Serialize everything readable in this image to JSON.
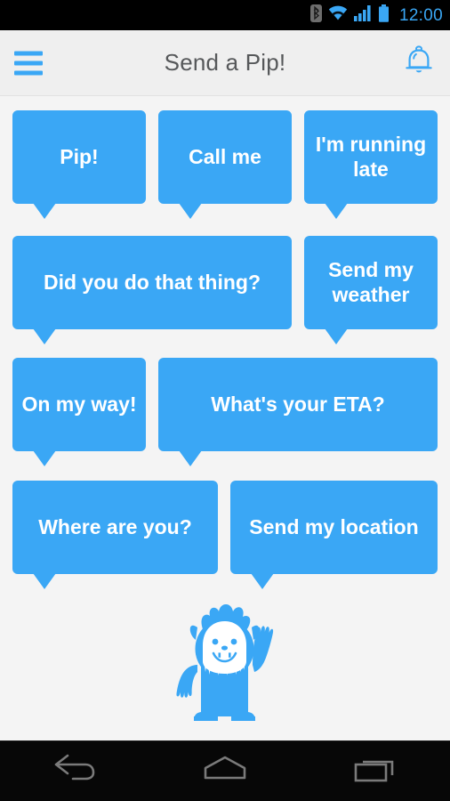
{
  "status_bar": {
    "time": "12:00",
    "time_color": "#3AA7F5",
    "background": "#000000",
    "icons": [
      {
        "name": "bluetooth-icon",
        "color": "#8a8a8a"
      },
      {
        "name": "wifi-icon",
        "color": "#3AA7F5"
      },
      {
        "name": "cellular-signal-icon",
        "color": "#3AA7F5"
      },
      {
        "name": "battery-icon",
        "color": "#3AA7F5"
      }
    ]
  },
  "header": {
    "title": "Send a Pip!",
    "title_color": "#56585a",
    "background": "#efefef",
    "menu_icon": "hamburger-menu-icon",
    "notification_icon": "bell-icon",
    "accent_color": "#3AA7F5"
  },
  "theme": {
    "bubble_blue": "#3AA7F5",
    "page_background": "#f4f4f4",
    "bubble_text": "#ffffff"
  },
  "bubbles": {
    "rows": [
      {
        "items": [
          {
            "id": "pip",
            "label": "Pip!"
          },
          {
            "id": "call-me",
            "label": "Call me"
          },
          {
            "id": "im-running-late",
            "label": "I'm running late"
          }
        ]
      },
      {
        "items": [
          {
            "id": "did-you-do-that-thing",
            "label": "Did you do that thing?"
          },
          {
            "id": "send-my-weather",
            "label": "Send my weather"
          }
        ]
      },
      {
        "items": [
          {
            "id": "on-my-way",
            "label": "On my way!"
          },
          {
            "id": "whats-your-eta",
            "label": "What's your ETA?"
          }
        ]
      },
      {
        "items": [
          {
            "id": "where-are-you",
            "label": "Where are you?"
          },
          {
            "id": "send-my-location",
            "label": "Send my location"
          }
        ]
      }
    ]
  },
  "mascot": {
    "name": "pip-yeti-mascot",
    "body_color": "#3AA7F5",
    "face_color": "#ffffff",
    "description": "Blue yeti character waving one arm"
  },
  "nav_bar": {
    "background": "#070707",
    "icon_color": "#7a7a7a",
    "buttons": [
      {
        "id": "back",
        "icon": "back-arrow-icon"
      },
      {
        "id": "home",
        "icon": "home-icon"
      },
      {
        "id": "recents",
        "icon": "recent-apps-icon"
      }
    ]
  }
}
